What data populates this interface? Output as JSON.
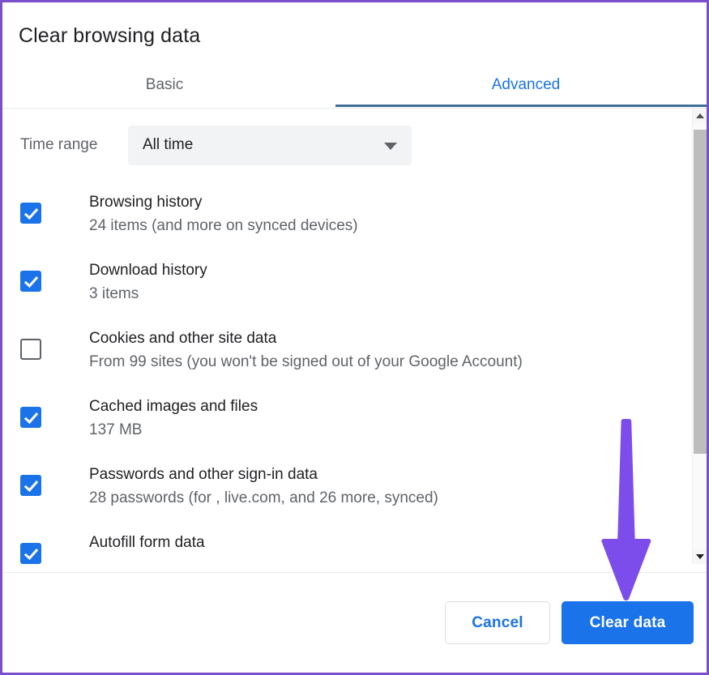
{
  "dialog": {
    "title": "Clear browsing data"
  },
  "tabs": [
    {
      "label": "Basic",
      "active": false
    },
    {
      "label": "Advanced",
      "active": true
    }
  ],
  "time_range": {
    "label": "Time range",
    "value": "All time",
    "caret_icon": "chevron-down-icon"
  },
  "options": [
    {
      "title": "Browsing history",
      "subtitle": "24 items (and more on synced devices)",
      "checked": true
    },
    {
      "title": "Download history",
      "subtitle": "3 items",
      "checked": true
    },
    {
      "title": "Cookies and other site data",
      "subtitle": "From 99 sites (you won't be signed out of your Google Account)",
      "checked": false
    },
    {
      "title": "Cached images and files",
      "subtitle": "137 MB",
      "checked": true
    },
    {
      "title": "Passwords and other sign-in data",
      "subtitle": "28 passwords (for , live.com, and 26 more, synced)",
      "checked": true
    },
    {
      "title": "Autofill form data",
      "subtitle": "",
      "checked": true
    }
  ],
  "scrollbar": {
    "up_icon": "scroll-up-arrow-icon",
    "down_icon": "scroll-down-arrow-icon"
  },
  "footer": {
    "cancel_label": "Cancel",
    "clear_label": "Clear data"
  },
  "annotation": {
    "arrow_icon": "down-arrow-annotation-icon",
    "color": "#7c4dea"
  },
  "colors": {
    "accent": "#1a73e8",
    "tab_underline": "#3f6f96",
    "muted_text": "#5f6368",
    "primary_text": "#202124",
    "frame_border": "#7b4fc9",
    "annotation_purple": "#7c4dea",
    "select_background": "#f1f3f4"
  }
}
